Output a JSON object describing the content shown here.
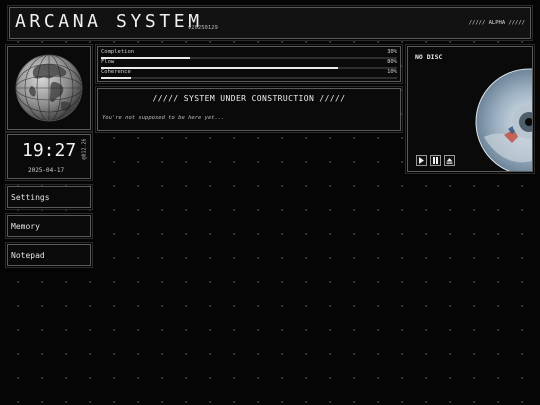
{
  "header": {
    "title": "ARCANA SYSTEM",
    "version": "v20250129",
    "badge": "///// ALPHA /////"
  },
  "clock": {
    "time": "19:27",
    "seconds": "@812.26",
    "date": "2025-04-17"
  },
  "menu": {
    "items": [
      {
        "label": "Settings"
      },
      {
        "label": "Memory"
      },
      {
        "label": "Notepad"
      }
    ]
  },
  "progress": {
    "items": [
      {
        "label": "Completion",
        "value": "30%",
        "fraction": 0.3
      },
      {
        "label": "Flow",
        "value": "80%",
        "fraction": 0.8
      },
      {
        "label": "Coherence",
        "value": "10%",
        "fraction": 0.1
      }
    ]
  },
  "construction": {
    "title": "///// SYSTEM UNDER CONSTRUCTION /////",
    "message": "You're not supposed to be here yet..."
  },
  "player": {
    "status": "NO DISC"
  },
  "colors": {
    "background": "#050505",
    "panel_border": "#5a5a5a",
    "text": "#e6e6e6",
    "bar_fill": "#eaeaea"
  }
}
